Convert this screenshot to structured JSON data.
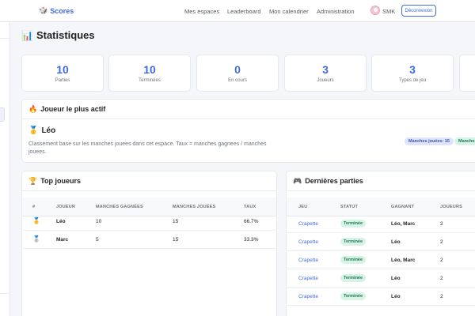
{
  "header": {
    "brand": "Scores",
    "nav": [
      "Mes espaces",
      "Leaderboard",
      "Mon calendrier",
      "Administration"
    ],
    "user": "SMK",
    "logout": "Déconnexion"
  },
  "page": {
    "title": "Statistiques"
  },
  "stats": [
    {
      "value": "10",
      "label": "Parties"
    },
    {
      "value": "10",
      "label": "Terminées"
    },
    {
      "value": "0",
      "label": "En cours"
    },
    {
      "value": "3",
      "label": "Joueurs"
    },
    {
      "value": "3",
      "label": "Types de jeu"
    }
  ],
  "most_active": {
    "title": "Joueur le plus actif",
    "name": "Léo",
    "description": "Classement base sur les manches jouees dans cet espace. Taux = manches gagnees / manches jouees.",
    "badges": [
      "Manches jouées: 15",
      "Manches"
    ]
  },
  "top_players": {
    "title": "Top joueurs",
    "columns": [
      "#",
      "JOUEUR",
      "MANCHES GAGNÉES",
      "MANCHES JOUÉES",
      "TAUX"
    ],
    "rows": [
      {
        "medal": "🥇",
        "player": "Léo",
        "won": "10",
        "played": "15",
        "rate": "66.7%"
      },
      {
        "medal": "🥈",
        "player": "Marc",
        "won": "5",
        "played": "15",
        "rate": "33.3%"
      }
    ]
  },
  "recent_games": {
    "title": "Dernières parties",
    "columns": [
      "JEU",
      "STATUT",
      "GAGNANT",
      "JOUEURS"
    ],
    "rows": [
      {
        "game": "Crapette",
        "status": "Terminée",
        "winner": "Léo, Marc",
        "players": "2"
      },
      {
        "game": "Crapette",
        "status": "Terminée",
        "winner": "Léo",
        "players": "2"
      },
      {
        "game": "Crapette",
        "status": "Terminée",
        "winner": "Léo, Marc",
        "players": "2"
      },
      {
        "game": "Crapette",
        "status": "Terminée",
        "winner": "Léo",
        "players": "2"
      },
      {
        "game": "Crapette",
        "status": "Terminée",
        "winner": "Léo",
        "players": "2"
      }
    ]
  }
}
